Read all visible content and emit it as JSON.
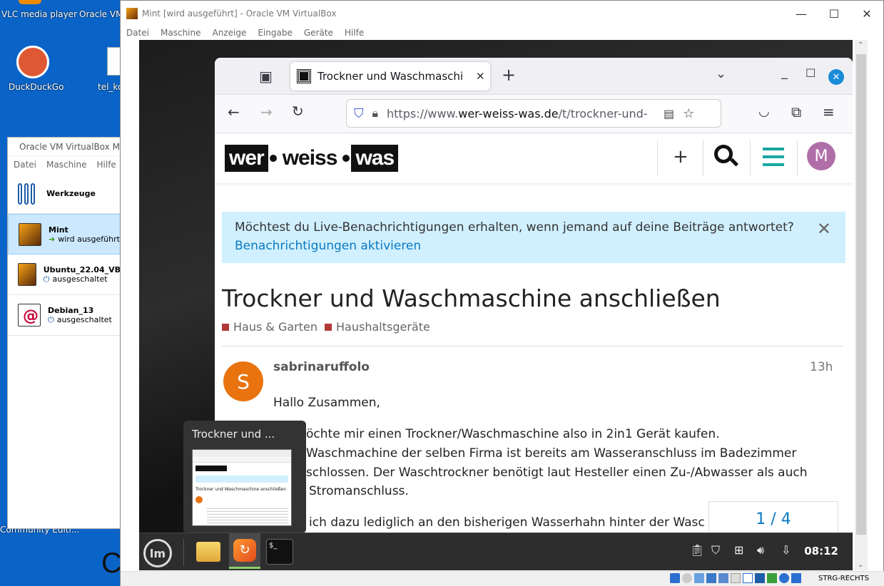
{
  "desktop": {
    "icons": [
      {
        "label": "VLC media player",
        "icon": "vlc-icon"
      },
      {
        "label": "Oracle VM",
        "icon": "virtualbox-icon"
      },
      {
        "label": "DuckDuckGo",
        "icon": "duckduckgo-icon"
      },
      {
        "label": "tel_ko",
        "icon": "file-icon"
      }
    ],
    "partial_label": "Community Editi..."
  },
  "manager": {
    "title": "Oracle VM VirtualBox Ma",
    "menu": [
      "Datei",
      "Maschine",
      "Hilfe"
    ],
    "tools_label": "Werkzeuge",
    "vms": [
      {
        "name": "Mint",
        "state": "wird ausgeführt",
        "selected": true
      },
      {
        "name": "Ubuntu_22.04_VB",
        "state": "ausgeschaltet",
        "selected": false
      },
      {
        "name": "Debian_13",
        "state": "ausgeschaltet",
        "selected": false
      }
    ]
  },
  "vmwindow": {
    "title": "Mint [wird ausgeführt] - Oracle VM VirtualBox",
    "menu": [
      "Datei",
      "Maschine",
      "Anzeige",
      "Eingabe",
      "Geräte",
      "Hilfe"
    ],
    "hostkey": "STRG-RECHTS"
  },
  "browser": {
    "tab_title": "Trockner und Waschmaschi",
    "url_prefix": "https://www.",
    "url_domain": "wer-weiss-was.de",
    "url_rest": "/t/trockner-und-",
    "logo": [
      "wer",
      "weiss",
      "was"
    ],
    "profile_initial": "M"
  },
  "page": {
    "banner_question": "Möchtest du Live-Benachrichtigungen erhalten, wenn jemand auf deine Beiträge antwortet?",
    "banner_action": "Benachrichtigungen aktivieren",
    "title": "Trockner und Waschmaschine anschließen",
    "categories": [
      "Haus & Garten",
      "Haushaltsgeräte"
    ],
    "author": "sabrinaruffolo",
    "author_initial": "S",
    "time": "13h",
    "greeting": "Hallo Zusammen,",
    "lines": [
      "öchte mir einen Trockner/Waschmaschine also in 2in1 Gerät kaufen.",
      "Waschmachine der selben Firma ist bereits am Wasseranschluss im Badezimmer",
      "schlossen. Der Waschtrockner benötigt laut Hesteller einen Zu-/Abwasser als auch",
      "Stromanschluss.",
      "ich dazu lediglich an den bisherigen Wasserhahn hinter der Wasc"
    ],
    "progress": "1 / 4"
  },
  "taskbar": {
    "preview_title": "Trockner und ...",
    "thumb_title": "Trockner und Waschmaschine anschließen",
    "clock": "08:12"
  }
}
